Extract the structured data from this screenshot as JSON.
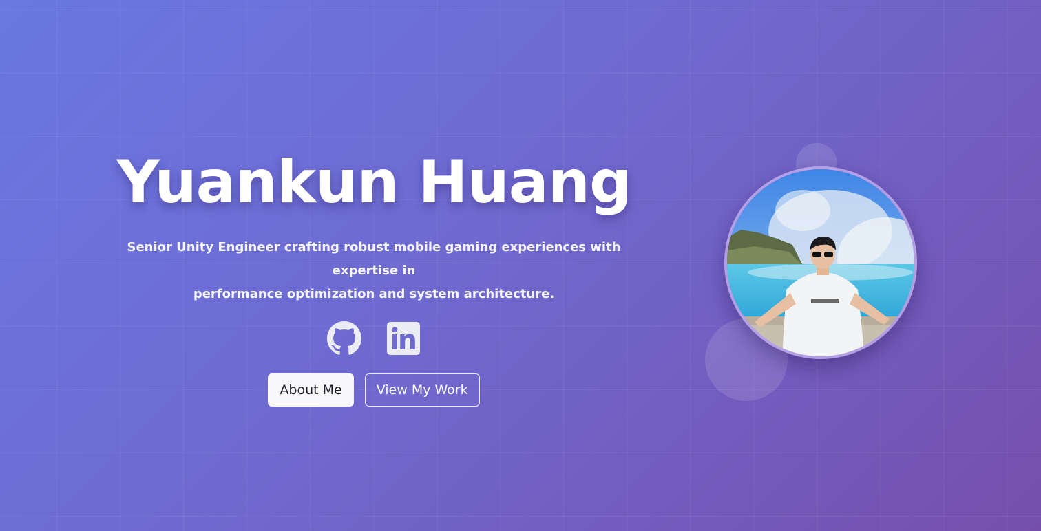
{
  "hero": {
    "name": "Yuankun Huang",
    "tagline_line1": "Senior Unity Engineer crafting robust mobile gaming experiences with expertise in",
    "tagline_line2": "performance optimization and system architecture."
  },
  "social": [
    {
      "label": "GitHub",
      "icon": "github-icon"
    },
    {
      "label": "LinkedIn",
      "icon": "linkedin-icon"
    }
  ],
  "buttons": {
    "about": "About Me",
    "work": "View My Work"
  },
  "avatar": {
    "description_icon": "profile-photo"
  },
  "colors": {
    "gradient_start": "#6a78e2",
    "gradient_end": "#764fad",
    "text": "#ffffff",
    "button_bg": "#f8f8fb"
  }
}
